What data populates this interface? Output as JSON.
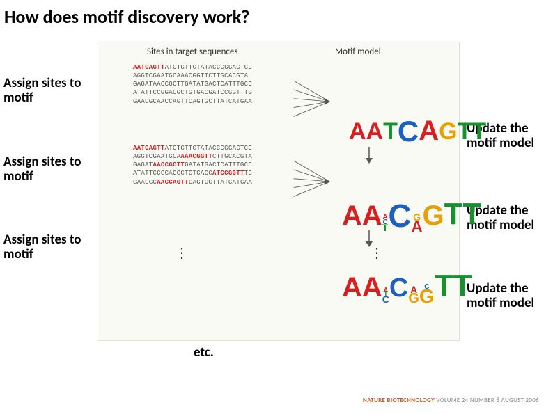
{
  "title": "How does motif discovery work?",
  "columns": {
    "target": "Sites in target sequences",
    "motif": "Motif model"
  },
  "labels": {
    "assign1": "Assign sites to motif",
    "assign2": "Assign sites to motif",
    "assign3": "Assign sites to motif",
    "update1": "Update the motif model",
    "update2": "Update the motif model",
    "update3": "Update the motif model",
    "etc": "etc."
  },
  "sequences1": {
    "s1a": "AATCAGTT",
    "s1b": "ATCTGTTGTATACCCGGAGTCC",
    "s2": "AGGTCGAATGCAAACGGTTCTTGCACGTA",
    "s3": "GAGATAACCGCTTGATATGACTCATTTGCC",
    "s4": "ATATTCCGGACGCTGTGACGATCCGGTTTG",
    "s5": "GAACGCAACCAGTTCAGTGCTTATCATGAA"
  },
  "sequences2": {
    "s1a": "AATCAGTT",
    "s1b": "ATCTGTTGTATACCCGGAGTCC",
    "s2a": "AGGTCGAATGCA",
    "s2b": "AAACGGTT",
    "s2c": "CTTGCACGTA",
    "s3a": "GAGAT",
    "s3b": "AACCGCTT",
    "s3c": "GATATGACTCATTTGCC",
    "s4a": "ATATTCCGGACGCTGTGACG",
    "s4b": "ATCCGGTT",
    "s4c": "TG",
    "s5a": "GAACGC",
    "s5b": "AACCAGTT",
    "s5c": "CAGTGCTTATCATGAA"
  },
  "logo1_letters": "AATCAGTT",
  "logo2_main": "AA CAGTT",
  "logo3_main": "AA C  TT",
  "attribution": {
    "journal": "NATURE BIOTECHNOLOGY",
    "rest": " VOLUME 24  NUMBER 8  AUGUST 2006"
  }
}
